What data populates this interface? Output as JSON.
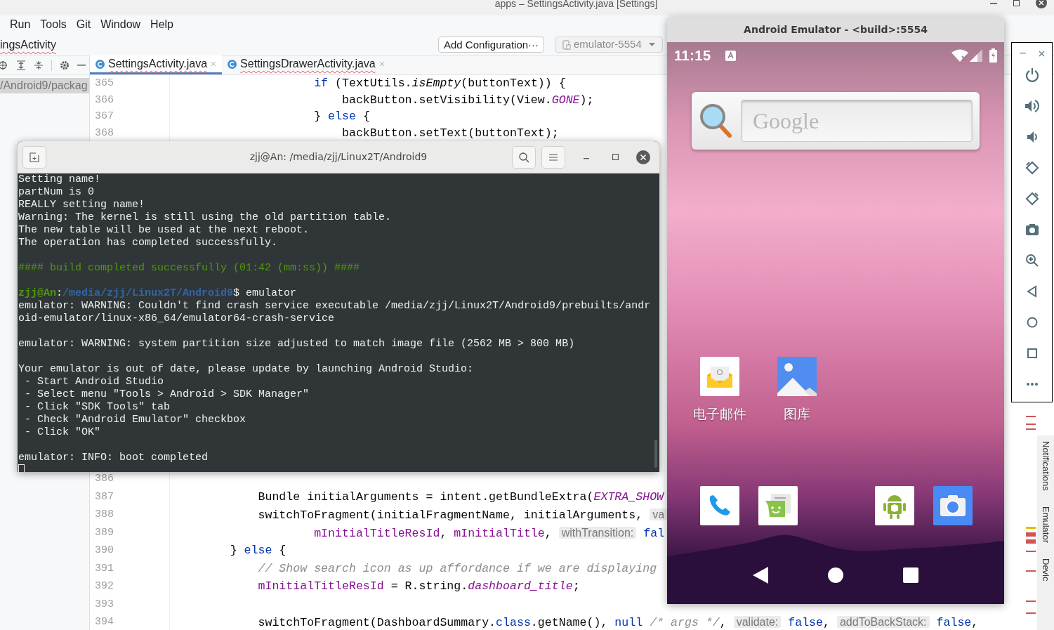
{
  "ide": {
    "title": "apps – SettingsActivity.java [Settings]",
    "menu": [
      "Run",
      "Tools",
      "Git",
      "Window",
      "Help"
    ],
    "breadcrumb": "ingsActivity",
    "add_configuration": "Add Configuration···",
    "device_selector": {
      "label": "emulator-5554",
      "disabled": true
    },
    "project_tree": [
      {
        "label": "/Android9/packag",
        "selected": true
      }
    ],
    "tabs": [
      {
        "label": "SettingsActivity.java",
        "selected": true
      },
      {
        "label": "SettingsDrawerActivity.java",
        "selected": false
      }
    ],
    "code_top": [
      {
        "number": "365",
        "segments": [
          {
            "text": "                    if",
            "kind": "keyword"
          },
          {
            "text": " (TextUtils.",
            "kind": "plain"
          },
          {
            "text": "isEmpty",
            "kind": "static"
          },
          {
            "text": "(buttonText)) {",
            "kind": "plain"
          }
        ]
      },
      {
        "number": "366",
        "segments": [
          {
            "text": "                        backButton.setVisibility(View.",
            "kind": "plain"
          },
          {
            "text": "GONE",
            "kind": "const"
          },
          {
            "text": ");",
            "kind": "plain"
          }
        ]
      },
      {
        "number": "367",
        "segments": [
          {
            "text": "                    } ",
            "kind": "plain"
          },
          {
            "text": "else",
            "kind": "keyword"
          },
          {
            "text": " {",
            "kind": "plain"
          }
        ]
      },
      {
        "number": "368",
        "segments": [
          {
            "text": "                        backButton.setText(buttonText);",
            "kind": "plain"
          }
        ]
      }
    ],
    "code_bottom": [
      {
        "number": "386"
      },
      {
        "number": "387",
        "segments": [
          {
            "text": "            Bundle initialArguments = intent.getBundleExtra(",
            "kind": "plain"
          },
          {
            "text": "EXTRA_SHOW",
            "kind": "const"
          }
        ]
      },
      {
        "number": "388",
        "segments": [
          {
            "text": "            switchToFragment(initialFragmentName, initialArguments, ",
            "kind": "plain"
          },
          {
            "text": "va",
            "kind": "hint"
          }
        ]
      },
      {
        "number": "389",
        "segments": [
          {
            "text": "                    mInitialTitleResId",
            "kind": "field"
          },
          {
            "text": ", ",
            "kind": "plain"
          },
          {
            "text": "mInitialTitle",
            "kind": "field"
          },
          {
            "text": ", ",
            "kind": "plain"
          },
          {
            "text": "withTransition:",
            "kind": "hint"
          },
          {
            "text": " fal",
            "kind": "keyword"
          }
        ]
      },
      {
        "number": "390",
        "segments": [
          {
            "text": "        } ",
            "kind": "plain"
          },
          {
            "text": "else",
            "kind": "keyword"
          },
          {
            "text": " {",
            "kind": "plain"
          }
        ]
      },
      {
        "number": "391",
        "segments": [
          {
            "text": "            // Show search icon as up affordance if we are displaying",
            "kind": "comment"
          }
        ]
      },
      {
        "number": "392",
        "segments": [
          {
            "text": "            mInitialTitleResId",
            "kind": "field"
          },
          {
            "text": " = R.string.",
            "kind": "plain"
          },
          {
            "text": "dashboard_title",
            "kind": "const"
          },
          {
            "text": ";",
            "kind": "plain"
          }
        ]
      },
      {
        "number": "393"
      },
      {
        "number": "394",
        "segments": [
          {
            "text": "            switchToFragment(DashboardSummary.",
            "kind": "plain"
          },
          {
            "text": "class",
            "kind": "keyword"
          },
          {
            "text": ".getName(), ",
            "kind": "plain"
          },
          {
            "text": "null",
            "kind": "keyword"
          },
          {
            "text": " /* args */",
            "kind": "comment"
          },
          {
            "text": ", ",
            "kind": "plain"
          },
          {
            "text": "validate:",
            "kind": "hint"
          },
          {
            "text": " false",
            "kind": "keyword"
          },
          {
            "text": ", ",
            "kind": "plain"
          },
          {
            "text": "addToBackStack:",
            "kind": "hint"
          },
          {
            "text": " false",
            "kind": "keyword"
          },
          {
            "text": ",",
            "kind": "plain"
          }
        ]
      }
    ],
    "tool_windows": [
      {
        "label": "Notifications"
      },
      {
        "label": "Emulator"
      },
      {
        "label": "Devic"
      }
    ]
  },
  "terminal": {
    "title": "zjj@An: /media/zjj/Linux2T/Android9",
    "lines": [
      {
        "kind": "text",
        "segments": [
          {
            "text": "Setting name!",
            "kind": "plain"
          }
        ]
      },
      {
        "kind": "text",
        "segments": [
          {
            "text": "partNum is 0",
            "kind": "plain"
          }
        ]
      },
      {
        "kind": "text",
        "segments": [
          {
            "text": "REALLY setting name!",
            "kind": "plain"
          }
        ]
      },
      {
        "kind": "text",
        "segments": [
          {
            "text": "Warning: The kernel is still using the old partition table.",
            "kind": "plain"
          }
        ]
      },
      {
        "kind": "text",
        "segments": [
          {
            "text": "The new table will be used at the next reboot.",
            "kind": "plain"
          }
        ]
      },
      {
        "kind": "text",
        "segments": [
          {
            "text": "The operation has completed successfully.",
            "kind": "plain"
          }
        ]
      },
      {
        "kind": "blank"
      },
      {
        "kind": "text",
        "segments": [
          {
            "text": "#### build completed successfully (01:42 (mm:ss)) ####",
            "kind": "success"
          }
        ]
      },
      {
        "kind": "blank"
      },
      {
        "kind": "text",
        "segments": [
          {
            "text": "zjj@An",
            "kind": "user"
          },
          {
            "text": ":",
            "kind": "plain"
          },
          {
            "text": "/media/zjj/Linux2T/Android9",
            "kind": "path"
          },
          {
            "text": "$ emulator",
            "kind": "plain"
          }
        ]
      },
      {
        "kind": "text",
        "segments": [
          {
            "text": "emulator: WARNING: Couldn't find crash service executable /media/zjj/Linux2T/Android9/prebuilts/andr",
            "kind": "plain"
          }
        ]
      },
      {
        "kind": "text",
        "segments": [
          {
            "text": "oid-emulator/linux-x86_64/emulator64-crash-service",
            "kind": "plain"
          }
        ]
      },
      {
        "kind": "blank"
      },
      {
        "kind": "text",
        "segments": [
          {
            "text": "emulator: WARNING: system partition size adjusted to match image file (2562 MB > 800 MB)",
            "kind": "plain"
          }
        ]
      },
      {
        "kind": "blank"
      },
      {
        "kind": "text",
        "segments": [
          {
            "text": "Your emulator is out of date, please update by launching Android Studio:",
            "kind": "plain"
          }
        ]
      },
      {
        "kind": "text",
        "segments": [
          {
            "text": " - Start Android Studio",
            "kind": "plain"
          }
        ]
      },
      {
        "kind": "text",
        "segments": [
          {
            "text": " - Select menu \"Tools > Android > SDK Manager\"",
            "kind": "plain"
          }
        ]
      },
      {
        "kind": "text",
        "segments": [
          {
            "text": " - Click \"SDK Tools\" tab",
            "kind": "plain"
          }
        ]
      },
      {
        "kind": "text",
        "segments": [
          {
            "text": " - Check \"Android Emulator\" checkbox",
            "kind": "plain"
          }
        ]
      },
      {
        "kind": "text",
        "segments": [
          {
            "text": " - Click \"OK\"",
            "kind": "plain"
          }
        ]
      },
      {
        "kind": "blank"
      },
      {
        "kind": "text",
        "segments": [
          {
            "text": "emulator: INFO: boot completed",
            "kind": "plain"
          }
        ]
      }
    ]
  },
  "emulator": {
    "title": "Android Emulator - <build>:5554",
    "time": "11:15",
    "search_hint": "Google",
    "apps": [
      {
        "label": "电子邮件"
      },
      {
        "label": "图库"
      }
    ]
  }
}
